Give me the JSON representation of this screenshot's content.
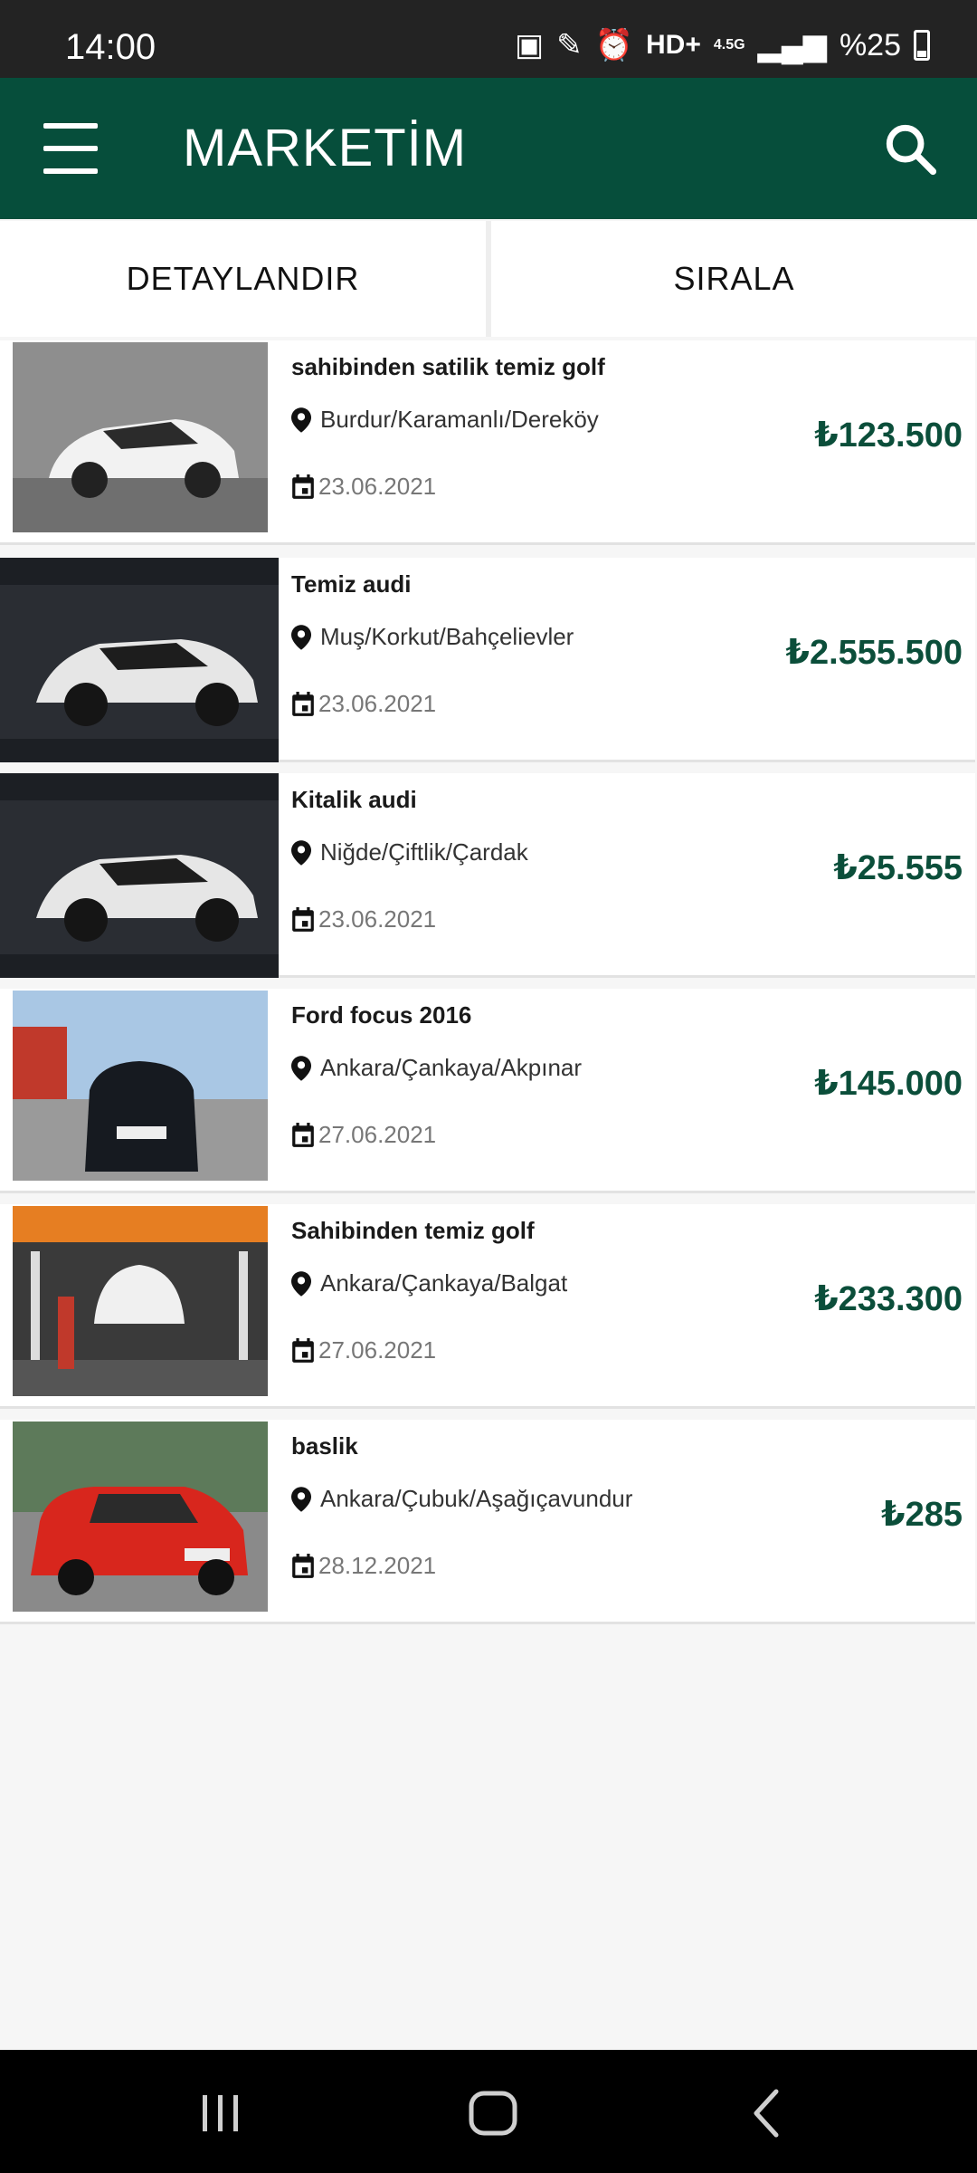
{
  "status": {
    "time": "14:00",
    "network": "HD+",
    "gen": "4.5G",
    "battery": "%25"
  },
  "header": {
    "title": "MARKETİM"
  },
  "tabs": [
    "DETAYLANDIR",
    "SIRALA"
  ],
  "listings": [
    {
      "title": "sahibinden satilik temiz golf",
      "location": "Burdur/Karamanlı/Dereköy",
      "date": "23.06.2021",
      "price": "₺123.500"
    },
    {
      "title": "Temiz audi",
      "location": "Muş/Korkut/Bahçelievler",
      "date": "23.06.2021",
      "price": "₺2.555.500"
    },
    {
      "title": "Kitalik audi",
      "location": "Niğde/Çiftlik/Çardak",
      "date": "23.06.2021",
      "price": "₺25.555"
    },
    {
      "title": "Ford focus 2016",
      "location": "Ankara/Çankaya/Akpınar",
      "date": "27.06.2021",
      "price": "₺145.000"
    },
    {
      "title": "Sahibinden temiz golf",
      "location": "Ankara/Çankaya/Balgat",
      "date": "27.06.2021",
      "price": "₺233.300"
    },
    {
      "title": "baslik",
      "location": "Ankara/Çubuk/Aşağıçavundur",
      "date": "28.12.2021",
      "price": "₺285"
    }
  ],
  "colors": {
    "brand": "#064e3b",
    "price": "#0b4e3a"
  }
}
